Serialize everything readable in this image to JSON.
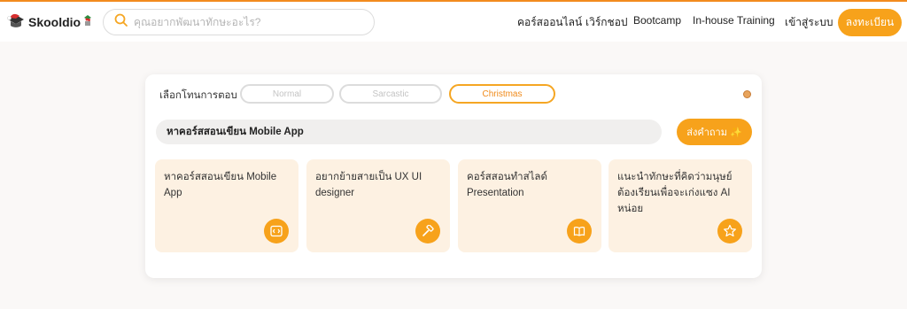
{
  "brand": {
    "name": "Skooldio",
    "accent": "#f7a21b"
  },
  "search": {
    "placeholder": "คุณอยากพัฒนาทักษะอะไร?"
  },
  "nav": {
    "items": [
      "คอร์สออนไลน์",
      "เวิร์กชอป",
      "Bootcamp",
      "In-house Training",
      "เข้าสู่ระบบ"
    ],
    "signup_label": "ลงทะเบียน"
  },
  "assistant": {
    "tone_label": "เลือกโทนการตอบ",
    "tones": [
      "Normal",
      "Sarcastic",
      "Christmas"
    ],
    "selected_tone": "Christmas",
    "query": "หาคอร์สสอนเขียน Mobile App",
    "ask_label": "ส่งคำถาม ✨",
    "suggestions": [
      {
        "text": "หาคอร์สสอนเขียน Mobile App",
        "icon": "code-icon"
      },
      {
        "text": "อยากย้ายสายเป็น UX UI designer",
        "icon": "hammer-icon"
      },
      {
        "text": "คอร์สสอนทำสไลด์ Presentation",
        "icon": "book-icon"
      },
      {
        "text": "แนะนำทักษะที่คิดว่ามนุษย์ต้องเรียนเพื่อจะเก่งแซง AI หน่อย",
        "icon": "star-icon"
      }
    ]
  }
}
